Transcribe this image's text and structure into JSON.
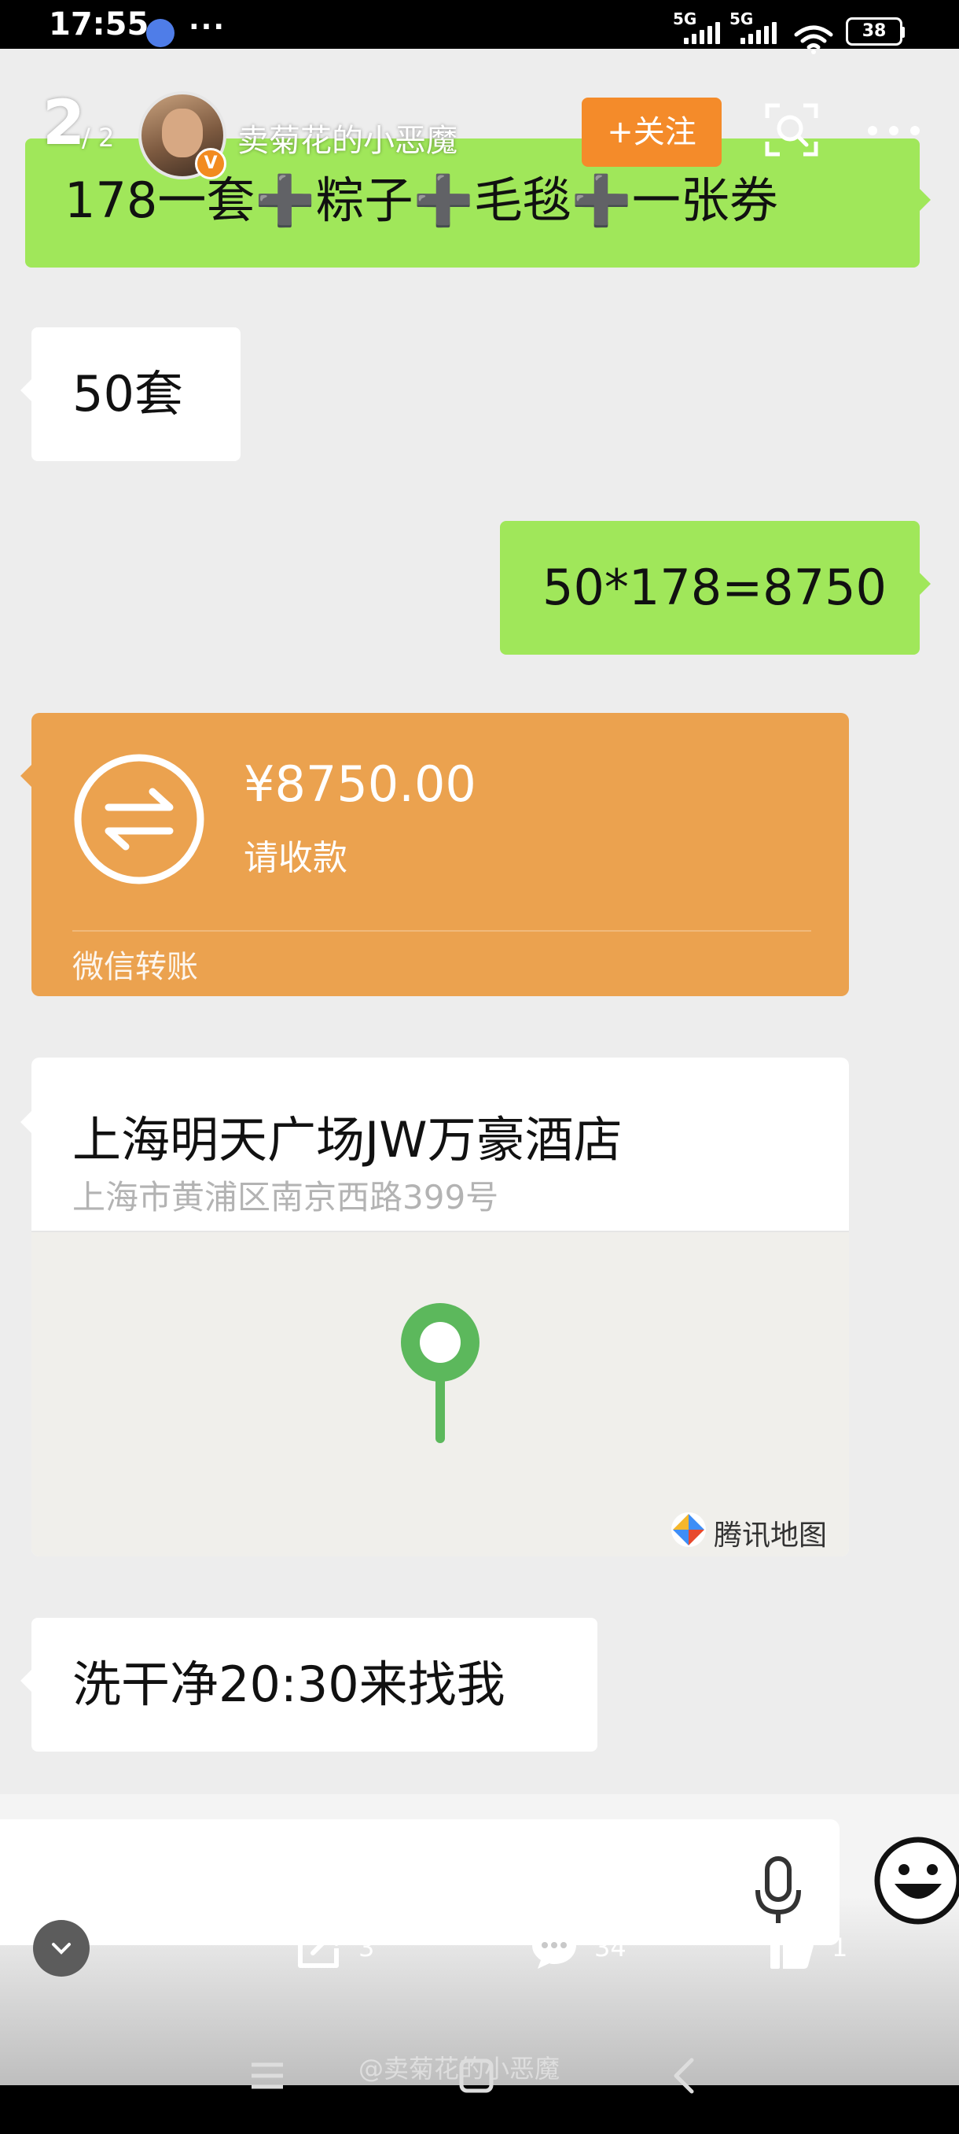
{
  "status_bar": {
    "time": "17:55",
    "more": "···",
    "network_1": "5G",
    "network_2": "5G",
    "battery": "38"
  },
  "weibo_header": {
    "counter_current": "2",
    "counter_total": "/ 2",
    "username": "卖菊花的小恶魔",
    "verified_badge": "V",
    "follow_label": "+关注"
  },
  "chat": {
    "messages": [
      {
        "side": "right",
        "type": "text",
        "text": "178一套➕粽子➕毛毯➕一张券"
      },
      {
        "side": "left",
        "type": "text",
        "text": "50套"
      },
      {
        "side": "right",
        "type": "text",
        "text": "50*178=8750"
      },
      {
        "side": "left",
        "type": "transfer",
        "amount": "¥8750.00",
        "status": "请收款",
        "source": "微信转账"
      },
      {
        "side": "left",
        "type": "location",
        "name": "上海明天广场JW万豪酒店",
        "address": "上海市黄浦区南京西路399号",
        "map_brand": "腾讯地图"
      },
      {
        "side": "left",
        "type": "text",
        "text": "洗干净20:30来找我"
      }
    ]
  },
  "action_bar": {
    "repost_count": "3",
    "comment_count": "34",
    "like_count": "1"
  },
  "watermark": "@卖菊花的小恶魔",
  "icons": {
    "status": [
      "app-icon",
      "signal-icon",
      "wifi-icon",
      "battery-icon"
    ],
    "header": [
      "avatar",
      "verified-badge",
      "scan-icon",
      "more-icon"
    ],
    "transfer": "transfer-arrows-icon",
    "map": [
      "map-pin-icon",
      "tencent-map-logo"
    ],
    "input": [
      "mic-icon",
      "emoji-icon"
    ],
    "actions": [
      "collapse-icon",
      "repost-icon",
      "comment-icon",
      "like-icon"
    ],
    "nav": [
      "menu-icon",
      "home-icon",
      "back-icon"
    ]
  },
  "colors": {
    "chat_background": "#ededed",
    "green_bubble": "#a0e75a",
    "transfer_card": "#eba24f",
    "follow_button": "#f48b2a",
    "map_pin": "#5cb85c"
  }
}
